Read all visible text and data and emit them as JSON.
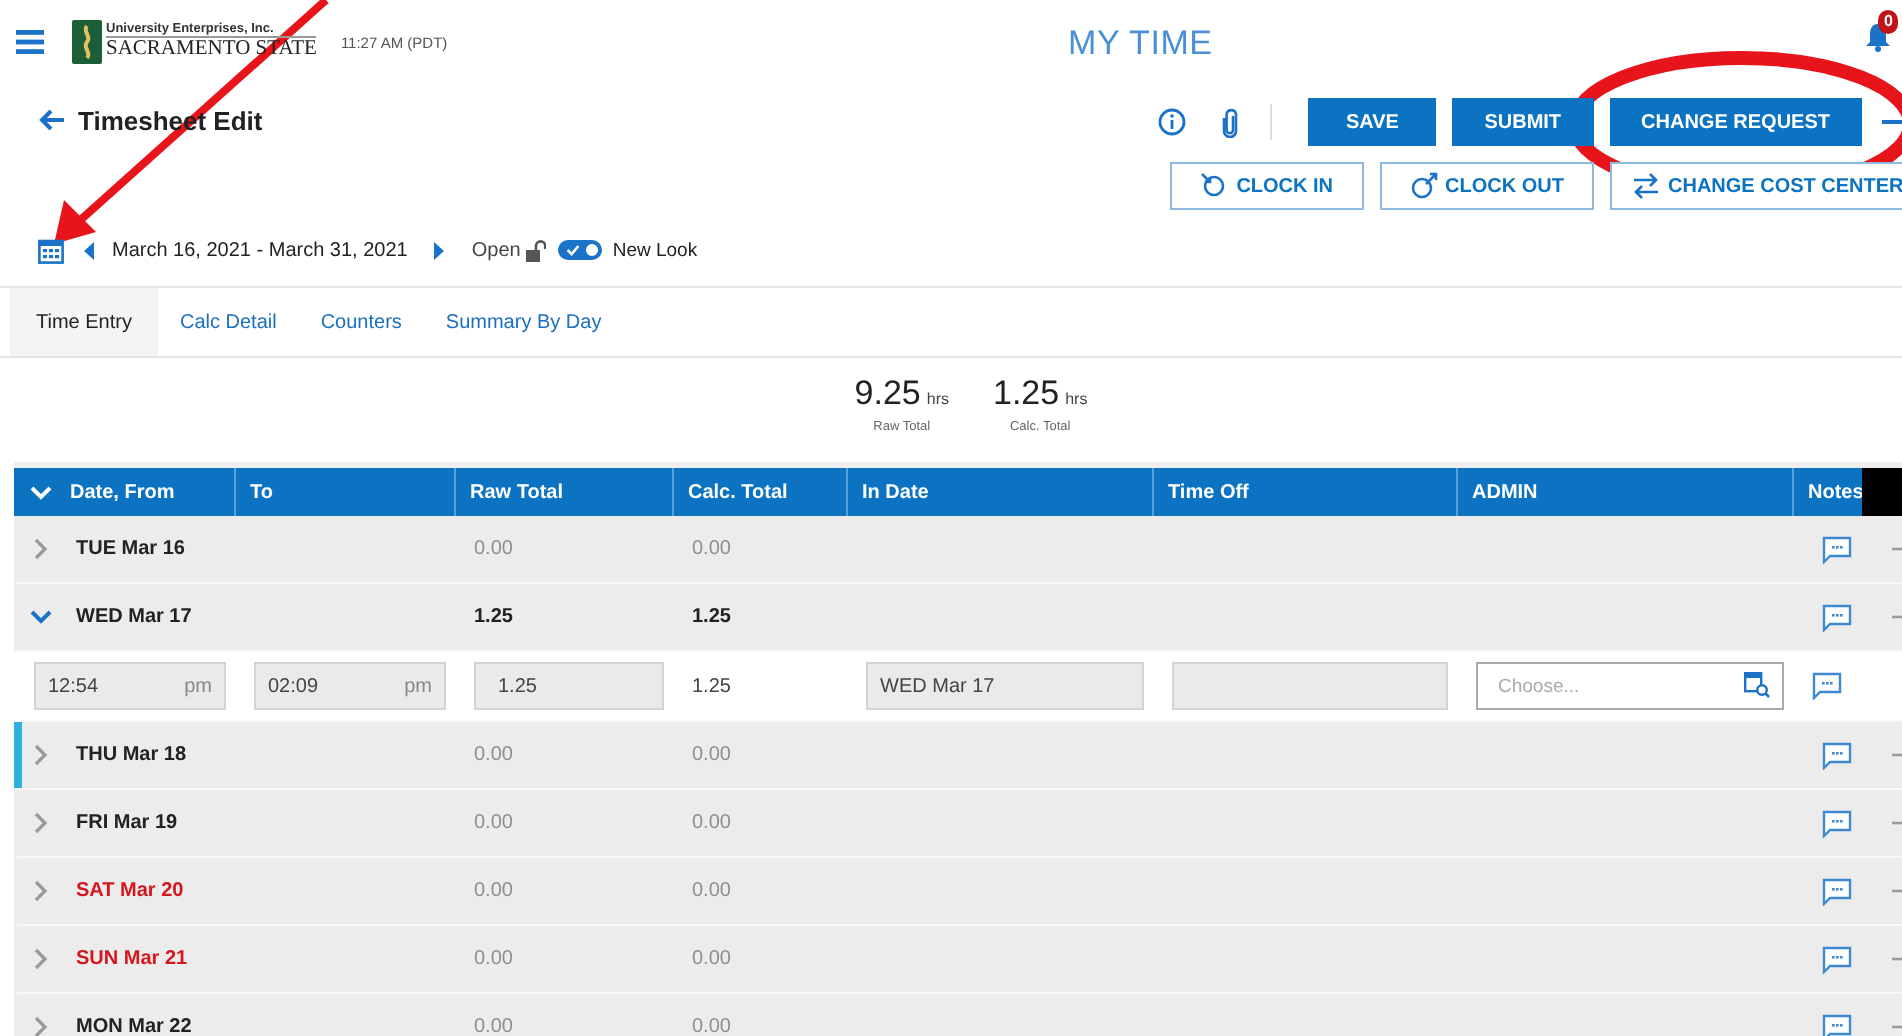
{
  "top_bar": {
    "org_line": "University Enterprises, Inc.",
    "org_name": "SACRAMENTO STATE",
    "time": "11:27 AM (PDT)",
    "app_title": "MY TIME",
    "notification_count": "0"
  },
  "page": {
    "title": "Timesheet Edit",
    "actions": [
      {
        "label": "SAVE",
        "kind": "primary"
      },
      {
        "label": "SUBMIT",
        "kind": "primary"
      },
      {
        "label": "CHANGE REQUEST",
        "kind": "primary"
      }
    ],
    "clock_actions": [
      {
        "label": "CLOCK IN",
        "kind": "in"
      },
      {
        "label": "CLOCK OUT",
        "kind": "out"
      },
      {
        "label": "CHANGE COST CENTER",
        "kind": "cost"
      }
    ]
  },
  "period": {
    "range": "March 16, 2021 - March 31, 2021",
    "status": "Open",
    "locked": false,
    "new_look": {
      "label": "New Look",
      "on": true
    }
  },
  "tabs": [
    {
      "label": "Time Entry",
      "selected": true
    },
    {
      "label": "Calc Detail",
      "selected": false
    },
    {
      "label": "Counters",
      "selected": false
    },
    {
      "label": "Summary By Day",
      "selected": false
    }
  ],
  "totals": [
    {
      "value": "9.25",
      "unit": "hrs",
      "label": "Raw Total"
    },
    {
      "value": "1.25",
      "unit": "hrs",
      "label": "Calc. Total"
    }
  ],
  "table": {
    "columns": [
      "Date, From",
      "To",
      "Raw Total",
      "Calc. Total",
      "In Date",
      "Time Off",
      "ADMIN",
      "Notes"
    ],
    "rows": [
      {
        "kind": "day",
        "date": "TUE Mar 16",
        "raw_total": "0.00",
        "calc_total": "0.00",
        "expanded": false,
        "weekend": false,
        "current": false,
        "dimmed": true
      },
      {
        "kind": "day",
        "date": "WED Mar 17",
        "raw_total": "1.25",
        "calc_total": "1.25",
        "expanded": true,
        "weekend": false,
        "current": false,
        "dimmed": false
      },
      {
        "kind": "entry",
        "from": "12:54",
        "from_suffix": "pm",
        "to": "02:09",
        "to_suffix": "pm",
        "raw_total": "1.25",
        "calc_total": "1.25",
        "in_date": "WED Mar 17",
        "admin_placeholder": "Choose..."
      },
      {
        "kind": "day",
        "date": "THU Mar 18",
        "raw_total": "0.00",
        "calc_total": "0.00",
        "expanded": false,
        "weekend": false,
        "current": true,
        "dimmed": true
      },
      {
        "kind": "day",
        "date": "FRI Mar 19",
        "raw_total": "0.00",
        "calc_total": "0.00",
        "expanded": false,
        "weekend": false,
        "current": false,
        "dimmed": true
      },
      {
        "kind": "day",
        "date": "SAT Mar 20",
        "raw_total": "0.00",
        "calc_total": "0.00",
        "expanded": false,
        "weekend": true,
        "current": false,
        "dimmed": true
      },
      {
        "kind": "day",
        "date": "SUN Mar 21",
        "raw_total": "0.00",
        "calc_total": "0.00",
        "expanded": false,
        "weekend": true,
        "current": false,
        "dimmed": true
      },
      {
        "kind": "day",
        "date": "MON Mar 22",
        "raw_total": "0.00",
        "calc_total": "0.00",
        "expanded": false,
        "weekend": false,
        "current": false,
        "dimmed": true
      }
    ]
  }
}
